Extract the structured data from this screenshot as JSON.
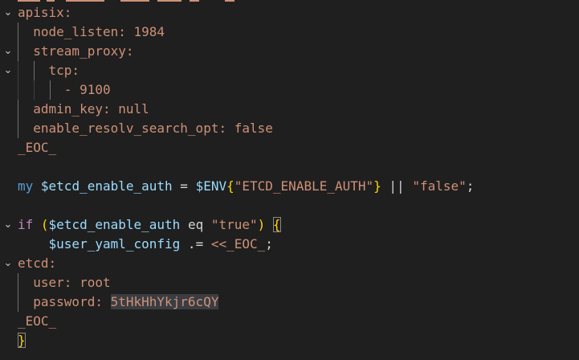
{
  "editor": {
    "lines": [
      {
        "fold": "⌄",
        "indent": 0,
        "tokens": [
          {
            "t": "apisix:",
            "c": "str"
          }
        ]
      },
      {
        "fold": "",
        "indent": 1,
        "tokens": [
          {
            "t": "  node_listen: 1984",
            "c": "str"
          }
        ]
      },
      {
        "fold": "⌄",
        "indent": 1,
        "tokens": [
          {
            "t": "  stream_proxy:",
            "c": "str"
          }
        ]
      },
      {
        "fold": "⌄",
        "indent": 2,
        "tokens": [
          {
            "t": "    tcp:",
            "c": "str"
          }
        ]
      },
      {
        "fold": "",
        "indent": 3,
        "tokens": [
          {
            "t": "      - 9100",
            "c": "str"
          }
        ]
      },
      {
        "fold": "",
        "indent": 1,
        "tokens": [
          {
            "t": "  admin_key: null",
            "c": "str"
          }
        ]
      },
      {
        "fold": "",
        "indent": 1,
        "tokens": [
          {
            "t": "  enable_resolv_search_opt: false",
            "c": "str"
          }
        ]
      },
      {
        "fold": "",
        "indent": 0,
        "tokens": [
          {
            "t": "_EOC_",
            "c": "str"
          }
        ]
      },
      {
        "fold": "",
        "indent": 0,
        "tokens": []
      },
      {
        "fold": "",
        "indent": 0,
        "tokens": [
          {
            "t": "my ",
            "c": "kw"
          },
          {
            "t": "$etcd_enable_auth",
            "c": "var"
          },
          {
            "t": " = ",
            "c": "op"
          },
          {
            "t": "$ENV",
            "c": "var"
          },
          {
            "t": "{",
            "c": "br"
          },
          {
            "t": "\"ETCD_ENABLE_AUTH\"",
            "c": "str"
          },
          {
            "t": "}",
            "c": "br"
          },
          {
            "t": " || ",
            "c": "op"
          },
          {
            "t": "\"false\"",
            "c": "str"
          },
          {
            "t": ";",
            "c": "op"
          }
        ]
      },
      {
        "fold": "",
        "indent": 0,
        "tokens": []
      },
      {
        "fold": "⌄",
        "indent": 0,
        "tokens": [
          {
            "t": "if",
            "c": "ctrl"
          },
          {
            "t": " ",
            "c": "op"
          },
          {
            "t": "(",
            "c": "br"
          },
          {
            "t": "$etcd_enable_auth",
            "c": "var"
          },
          {
            "t": " eq ",
            "c": "op"
          },
          {
            "t": "\"true\"",
            "c": "str"
          },
          {
            "t": ")",
            "c": "br"
          },
          {
            "t": " ",
            "c": "op"
          },
          {
            "t": "{",
            "c": "br",
            "box": true
          }
        ]
      },
      {
        "fold": "",
        "indent": 0,
        "tokens": [
          {
            "t": "    ",
            "c": "op"
          },
          {
            "t": "$user_yaml_config",
            "c": "var"
          },
          {
            "t": " .= ",
            "c": "op"
          },
          {
            "t": "<<_EOC_",
            "c": "str"
          },
          {
            "t": ";",
            "c": "op"
          }
        ]
      },
      {
        "fold": "⌄",
        "indent": 0,
        "tokens": [
          {
            "t": "etcd:",
            "c": "str"
          }
        ]
      },
      {
        "fold": "",
        "indent": 1,
        "tokens": [
          {
            "t": "  user: root",
            "c": "str"
          }
        ]
      },
      {
        "fold": "",
        "indent": 1,
        "tokens": [
          {
            "t": "  password: ",
            "c": "str"
          },
          {
            "t": "5tHkHhYkjr6cQY",
            "c": "str",
            "sel": true
          }
        ]
      },
      {
        "fold": "",
        "indent": 0,
        "tokens": [
          {
            "t": "_EOC_",
            "c": "str"
          }
        ]
      },
      {
        "fold": "",
        "indent": 0,
        "tokens": [
          {
            "t": "}",
            "c": "br",
            "box": true
          }
        ]
      }
    ]
  }
}
